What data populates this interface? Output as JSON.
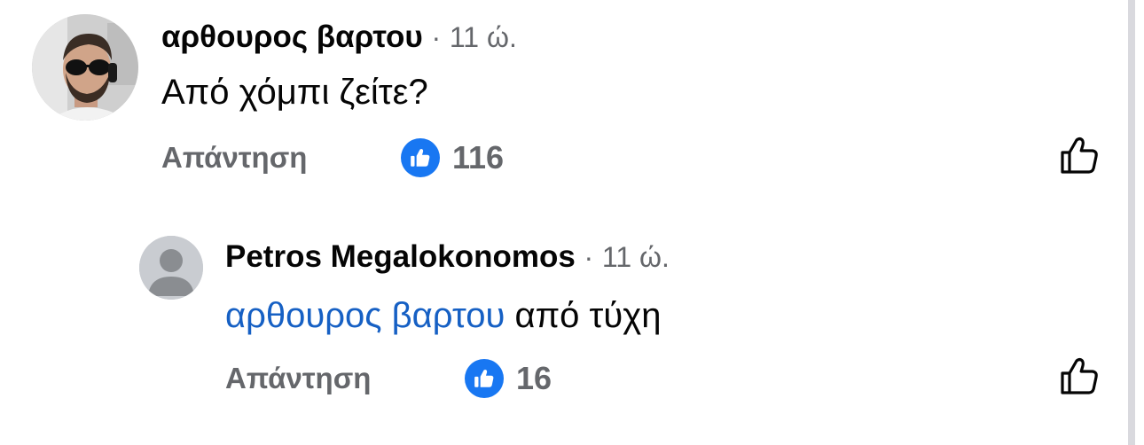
{
  "comments": [
    {
      "author": "αρθουρος βαρτου",
      "separator": "·",
      "time": "11 ώ.",
      "text": "Από χόμπι ζείτε?",
      "reply_label": "Απάντηση",
      "like_count": "116",
      "avatar": "profile-photo"
    },
    {
      "author": "Petros Megalokonomos",
      "separator": "·",
      "time": "11 ώ.",
      "mention": "αρθουρος βαρτου",
      "text": "από τύχη",
      "reply_label": "Απάντηση",
      "like_count": "16",
      "avatar": "default-avatar"
    }
  ],
  "colors": {
    "like_blue": "#1877f2",
    "mention_blue": "#1660c4",
    "meta_gray": "#65676b",
    "text": "#050505"
  },
  "icons": {
    "reaction_badge": "thumbs-up-filled-icon",
    "like_action": "thumbs-up-outline-icon"
  }
}
